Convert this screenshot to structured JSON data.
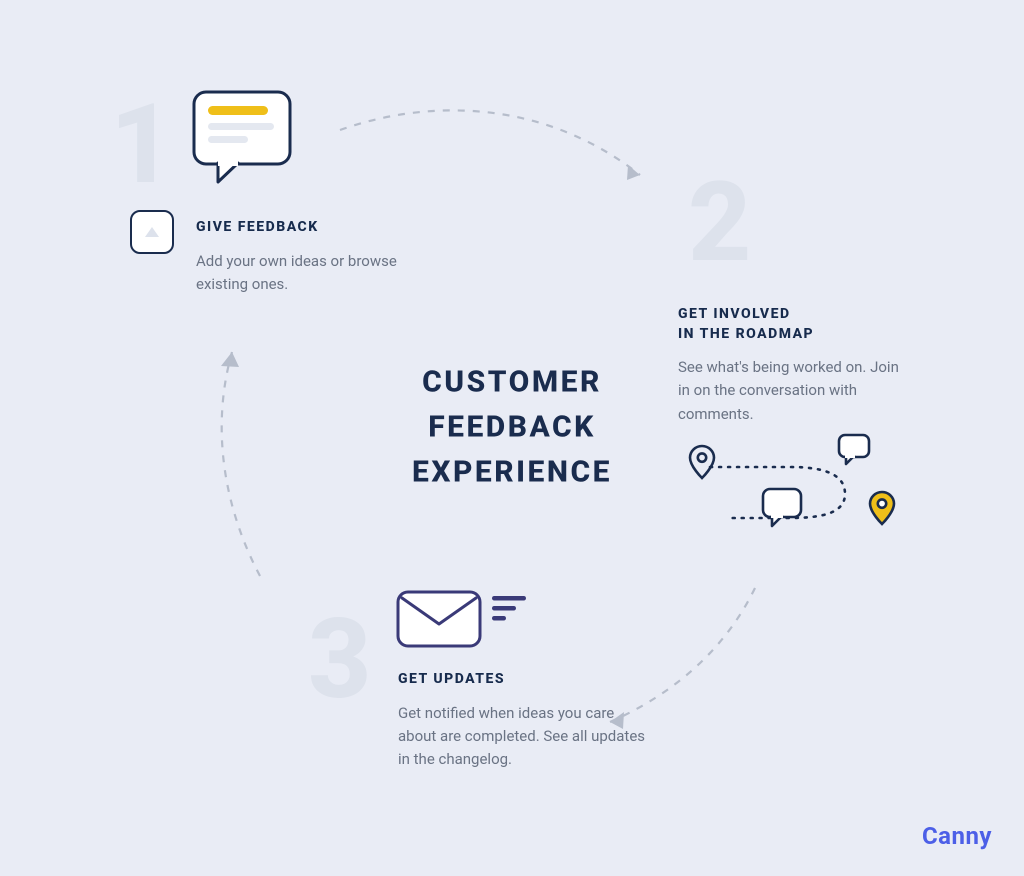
{
  "center": {
    "line1": "CUSTOMER",
    "line2": "FEEDBACK",
    "line3": "EXPERIENCE"
  },
  "steps": {
    "s1": {
      "num": "1",
      "title": "GIVE FEEDBACK",
      "body": "Add your own ideas or browse existing ones."
    },
    "s2": {
      "num": "2",
      "title1": "GET INVOLVED",
      "title2": "IN THE ROADMAP",
      "body": "See what's being worked on. Join in on the conversation with comments."
    },
    "s3": {
      "num": "3",
      "title": "GET UPDATES",
      "body": "Get notified when ideas you care about are completed. See all updates in the changelog."
    }
  },
  "brand": "Canny"
}
